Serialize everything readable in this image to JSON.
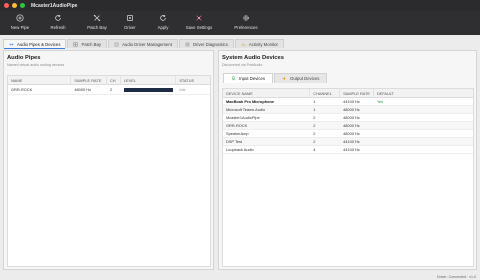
{
  "window": {
    "title": "Mcaster1AudioPipe"
  },
  "toolbar": {
    "items": [
      {
        "label": "New Pipe",
        "icon": "plus-circle-icon"
      },
      {
        "label": "Refresh",
        "icon": "refresh-icon"
      },
      {
        "label": "Patch Bay",
        "icon": "patch-bay-icon"
      },
      {
        "label": "Driver",
        "icon": "driver-icon"
      },
      {
        "label": "Apply",
        "icon": "apply-icon"
      },
      {
        "label": "Save Settings",
        "icon": "save-settings-icon"
      },
      {
        "label": "Preferences",
        "icon": "gear-icon"
      }
    ]
  },
  "tabs": [
    {
      "label": "Audio Pipes & Devices",
      "icon": "pipe-icon",
      "active": true
    },
    {
      "label": "Patch Bay",
      "icon": "grid-icon",
      "active": false
    },
    {
      "label": "Audio Driver Management",
      "icon": "driver-icon",
      "active": false
    },
    {
      "label": "Driver Diagnostics",
      "icon": "diagnostics-icon",
      "active": false
    },
    {
      "label": "Activity Monitor",
      "icon": "activity-icon",
      "active": false
    }
  ],
  "pipes": {
    "title": "Audio Pipes",
    "subtitle": "Named virtual audio routing devices",
    "columns": [
      "NAME",
      "SAMPLE RATE",
      "CH",
      "LEVEL",
      "STATUS"
    ],
    "rows": [
      {
        "name": "GRR-ROCK",
        "rate": "48000 Hz",
        "ch": "2",
        "level": 0.98,
        "status": "Idle"
      }
    ]
  },
  "devices": {
    "title": "System Audio Devices",
    "subtitle": "Discovered via PortAudio",
    "subtabs": [
      {
        "label": "Input Devices",
        "icon": "mic-icon",
        "active": true
      },
      {
        "label": "Output Devices",
        "icon": "speaker-icon",
        "active": false
      }
    ],
    "columns": [
      "DEVICE NAME",
      "CHANNEL",
      "SAMPLE RATE",
      "DEFAULT"
    ],
    "rows": [
      {
        "name": "MacBook Pro Microphone",
        "channels": "1",
        "rate": "44100 Hz",
        "default": "Yes",
        "highlight": true
      },
      {
        "name": "Microsoft Teams Audio",
        "channels": "1",
        "rate": "48000 Hz",
        "default": ""
      },
      {
        "name": "Mcaster1AudioPipe",
        "channels": "2",
        "rate": "48000 Hz",
        "default": ""
      },
      {
        "name": "GRR-ROCK",
        "channels": "2",
        "rate": "48000 Hz",
        "default": ""
      },
      {
        "name": "SpeakerAmp",
        "channels": "2",
        "rate": "48000 Hz",
        "default": ""
      },
      {
        "name": "DSP Test",
        "channels": "2",
        "rate": "44100 Hz",
        "default": ""
      },
      {
        "name": "Loopback Audio",
        "channels": "4",
        "rate": "44100 Hz",
        "default": ""
      }
    ]
  },
  "status": {
    "text": "Driver: Connected · v1.0"
  },
  "colors": {
    "accent": "#3b7ddd",
    "toolbar": "#2f2f31",
    "titlebar": "#2b2b2d",
    "default_yes": "#2e9b3e",
    "level": "#1c2a44"
  }
}
